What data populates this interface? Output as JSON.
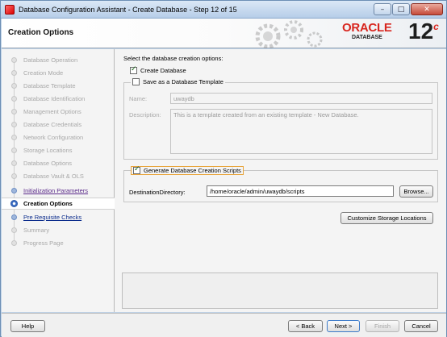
{
  "window": {
    "title": "Database Configuration Assistant - Create Database - Step 12 of 15",
    "minimize_glyph": "–",
    "maximize_glyph": "□",
    "close_glyph": "✕"
  },
  "header": {
    "title": "Creation Options",
    "logo_brand": "ORACLE",
    "logo_product": "DATABASE",
    "logo_version": "12",
    "logo_version_suffix": "c"
  },
  "nav": {
    "items": [
      {
        "label": "Database Operation",
        "state": "disabled"
      },
      {
        "label": "Creation Mode",
        "state": "disabled"
      },
      {
        "label": "Database Template",
        "state": "disabled"
      },
      {
        "label": "Database Identification",
        "state": "disabled"
      },
      {
        "label": "Management Options",
        "state": "disabled"
      },
      {
        "label": "Database Credentials",
        "state": "disabled"
      },
      {
        "label": "Network Configuration",
        "state": "disabled"
      },
      {
        "label": "Storage Locations",
        "state": "disabled"
      },
      {
        "label": "Database Options",
        "state": "disabled"
      },
      {
        "label": "Database Vault & OLS",
        "state": "disabled"
      },
      {
        "label": "Initialization Parameters",
        "state": "visited"
      },
      {
        "label": "Creation Options",
        "state": "current"
      },
      {
        "label": "Pre Requisite Checks",
        "state": "link"
      },
      {
        "label": "Summary",
        "state": "disabled"
      },
      {
        "label": "Progress Page",
        "state": "disabled"
      }
    ]
  },
  "main": {
    "prompt": "Select the database creation options:",
    "create_database": {
      "label": "Create Database",
      "checked": true
    },
    "save_template": {
      "label": "Save as a Database Template",
      "checked": false
    },
    "name_label": "Name:",
    "name_value": "uwaydb",
    "description_label": "Description:",
    "description_value": "This is a template created from an existing template - New Database.",
    "generate_scripts": {
      "label": "Generate Database Creation Scripts",
      "checked": true
    },
    "destination_label": "DestinationDirectory:",
    "destination_value": "/home/oracle/admin/uwaydb/scripts",
    "browse_label": "Browse...",
    "customize_storage_label": "Customize Storage Locations"
  },
  "footer": {
    "help_label": "Help",
    "back_label": "< Back",
    "next_label": "Next >",
    "finish_label": "Finish",
    "cancel_label": "Cancel"
  },
  "colors": {
    "oracle_red": "#d8261f",
    "link_blue": "#0b2c8c",
    "visited_purple": "#5a2a8a",
    "titlebar": "#b6cde8"
  }
}
